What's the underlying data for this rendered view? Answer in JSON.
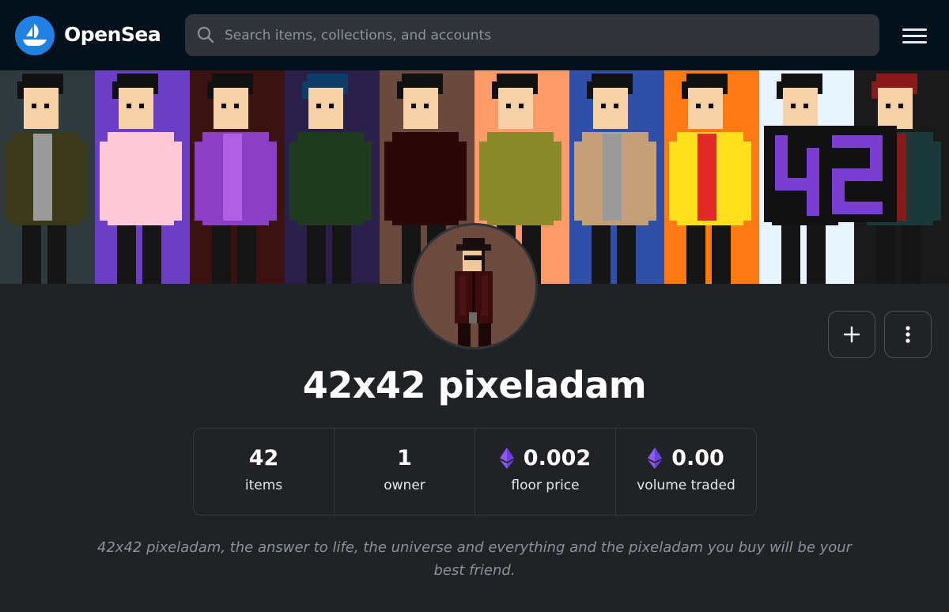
{
  "header": {
    "brand": "OpenSea",
    "logo_icon": "sailboat-logo-icon",
    "search_placeholder": "Search items, collections, and accounts",
    "search_icon": "search-icon",
    "menu_icon": "hamburger-menu-icon"
  },
  "colors": {
    "topbar_bg": "#04111d",
    "page_bg": "#202225",
    "brand_blue": "#2081e2",
    "eth_purple": "#8a5cf5"
  },
  "banner": {
    "panel_backgrounds": [
      "#2f3a3e",
      "#6a3fc4",
      "#3a1212",
      "#2a1f4a",
      "#6a4a3e",
      "#ff9a6b",
      "#2f4fa8",
      "#ff7a12",
      "#e8f4ff",
      "#1a1a1a"
    ]
  },
  "collection": {
    "name": "42x42 pixeladam",
    "description": "42x42 pixeladam, the answer to life, the universe and everything and the pixeladam you buy will be your best friend."
  },
  "actions": {
    "add_icon": "plus-icon",
    "more_icon": "more-vertical-icon"
  },
  "stats": [
    {
      "value": "42",
      "label": "items",
      "eth": false
    },
    {
      "value": "1",
      "label": "owner",
      "eth": false
    },
    {
      "value": "0.002",
      "label": "floor price",
      "eth": true
    },
    {
      "value": "0.00",
      "label": "volume traded",
      "eth": true
    }
  ]
}
